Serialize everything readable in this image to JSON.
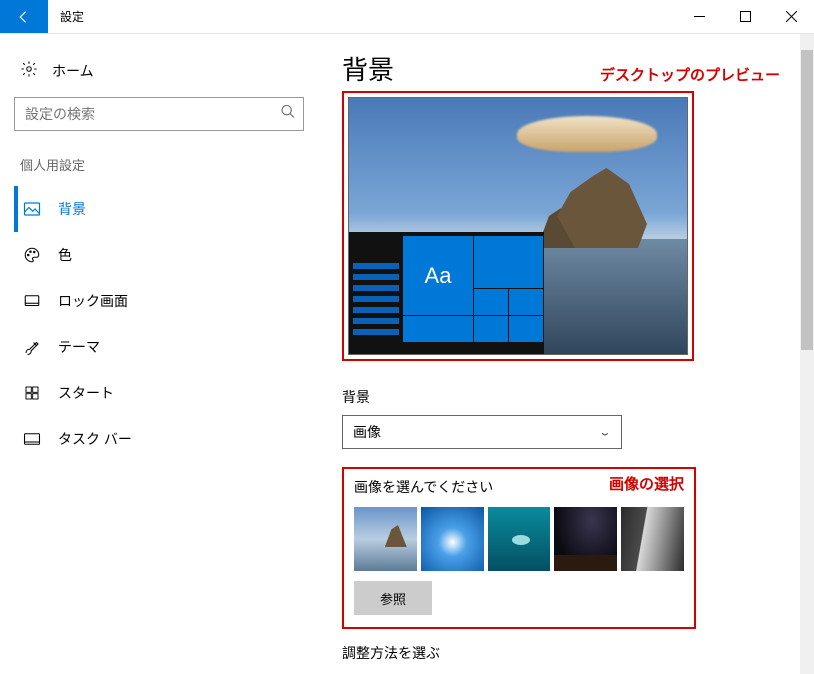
{
  "titlebar": {
    "app_name": "設定"
  },
  "left": {
    "home_label": "ホーム",
    "search_placeholder": "設定の検索",
    "section_label": "個人用設定",
    "items": [
      {
        "label": "背景"
      },
      {
        "label": "色"
      },
      {
        "label": "ロック画面"
      },
      {
        "label": "テーマ"
      },
      {
        "label": "スタート"
      },
      {
        "label": "タスク バー"
      }
    ]
  },
  "right": {
    "title": "背景",
    "annotation_preview": "デスクトップのプレビュー",
    "preview_tile_text": "Aa",
    "bg_field_label": "背景",
    "bg_select_value": "画像",
    "pick_label": "画像を選んでください",
    "annotation_pick": "画像の選択",
    "browse_label": "参照",
    "fit_label": "調整方法を選ぶ"
  }
}
